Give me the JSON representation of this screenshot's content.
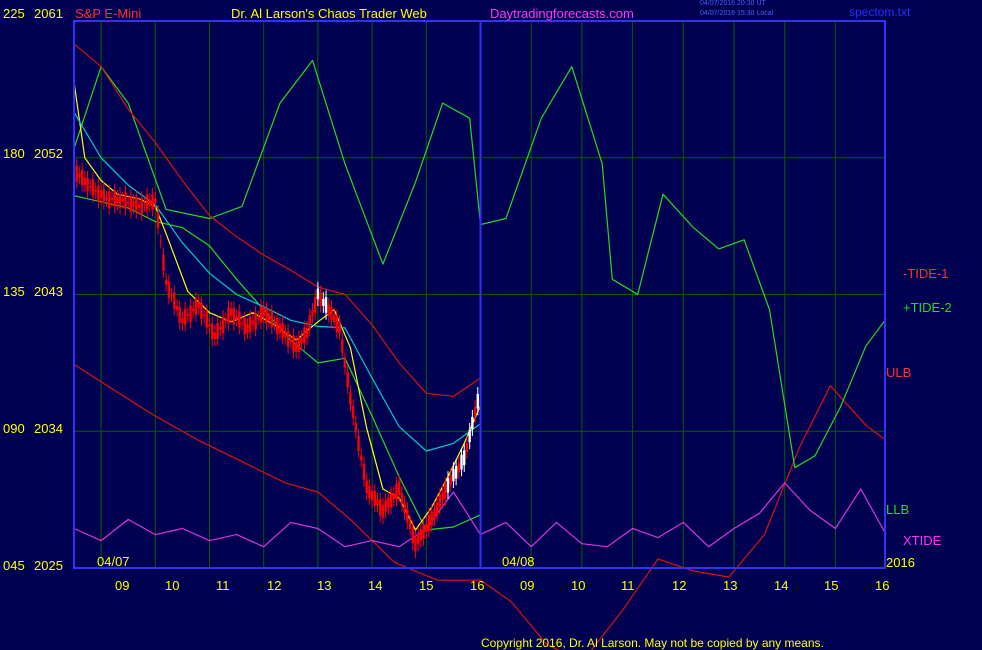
{
  "header": {
    "symbol": "S&P E-Mini",
    "title": "Dr. Al Larson's Chaos Trader Web",
    "website": "Daytradingforecasts.com",
    "stamp_ut": "04/07/2016 20:30 UT",
    "stamp_local": "04/07/2016 15:30 Local",
    "file": "spectom.txt"
  },
  "copyright": "Copyright 2016, Dr. Al Larson. May not be copied by any means.",
  "colors": {
    "background": "#000050",
    "plot_border": "#3030ff",
    "grid": "#006000",
    "axis_text": "#ffff00",
    "tide1": "#dd1010",
    "tide2": "#22dd22",
    "ulb": "#dd1010",
    "llb": "#22dd22",
    "xtide": "#dd33dd",
    "candle_down": "#ff0000",
    "candle_up": "#ffffff",
    "fast_ma": "#ffff00",
    "slow_ma": "#00cccc"
  },
  "chart_data": {
    "type": "line",
    "title": "S&P E-Mini",
    "y_axis_left": {
      "ticks": [
        "045",
        "090",
        "135",
        "180",
        "225"
      ],
      "range": [
        45,
        225
      ]
    },
    "y_axis_price": {
      "ticks": [
        "2025",
        "2034",
        "2043",
        "2052",
        "2061"
      ],
      "range": [
        2025,
        2061
      ]
    },
    "x_axis": {
      "hour_ticks": [
        "09",
        "10",
        "11",
        "12",
        "13",
        "14",
        "15",
        "16",
        "09",
        "10",
        "11",
        "12",
        "13",
        "14",
        "15",
        "16"
      ],
      "date_markers": [
        "04/07",
        "04/08"
      ],
      "year": "2016",
      "sessions": [
        "04/07",
        "04/08"
      ],
      "session_hours": [
        8.5,
        16.0
      ]
    },
    "series_labels": {
      "tide1": "-TIDE-1",
      "tide2": "+TIDE-2",
      "ulb": "ULB",
      "llb": "LLB",
      "xtide": "XTIDE"
    },
    "series": [
      {
        "name": "-TIDE-1",
        "unit": "index",
        "x": [
          8.5,
          9.2,
          10.0,
          10.8,
          11.6,
          12.4,
          13.0,
          13.6,
          14.4,
          15.2,
          16.0,
          16.6,
          17.3,
          18.0,
          18.8,
          19.5,
          20.2,
          20.9,
          21.6,
          22.3,
          22.9,
          23.6,
          24.0
        ],
        "y": [
          112,
          104,
          95,
          87,
          80,
          73,
          70,
          61,
          47,
          41,
          41,
          34,
          20,
          14,
          31,
          48,
          44,
          42,
          56,
          85,
          105,
          92,
          87
        ]
      },
      {
        "name": "+TIDE-2",
        "unit": "index",
        "x": [
          8.5,
          9.0,
          9.5,
          10.2,
          11.0,
          11.6,
          12.3,
          12.9,
          13.5,
          14.2,
          14.8,
          15.3,
          15.8,
          16.0,
          16.5,
          17.2,
          17.8,
          18.4,
          18.6,
          19.1,
          19.6,
          20.2,
          20.7,
          21.2,
          21.7,
          22.2,
          22.6,
          23.1,
          23.6,
          24.0
        ],
        "y": [
          183,
          210,
          198,
          163,
          160,
          164,
          198,
          212,
          178,
          145,
          172,
          198,
          193,
          158,
          160,
          193,
          210,
          178,
          140,
          135,
          168,
          157,
          150,
          153,
          130,
          78,
          82,
          98,
          118,
          127
        ]
      },
      {
        "name": "ULB",
        "unit": "price",
        "x": [
          8.5,
          9.0,
          9.5,
          10.0,
          10.5,
          11.0,
          11.5,
          12.0,
          12.5,
          13.0,
          13.5,
          14.0,
          14.5,
          15.0,
          15.5,
          16.0
        ],
        "y": [
          2059.5,
          2058,
          2055.2,
          2053,
          2050.5,
          2048.2,
          2046.8,
          2045.6,
          2044.6,
          2043.5,
          2043,
          2041,
          2038.5,
          2036.5,
          2036.3,
          2037.5
        ]
      },
      {
        "name": "LLB",
        "unit": "price",
        "x": [
          8.5,
          9.0,
          9.5,
          10.0,
          10.5,
          11.0,
          11.5,
          12.0,
          12.5,
          13.0,
          13.5,
          14.0,
          14.5,
          15.0,
          15.5,
          16.0
        ],
        "y": [
          2049.5,
          2049.1,
          2048.7,
          2047.8,
          2047.4,
          2046.2,
          2044,
          2042,
          2040,
          2038.5,
          2038.8,
          2035,
          2031,
          2027.5,
          2027.7,
          2028.5
        ]
      },
      {
        "name": "XTIDE",
        "unit": "index",
        "x": [
          8.5,
          9.0,
          9.5,
          10.0,
          10.5,
          11.0,
          11.5,
          12.0,
          12.5,
          13.0,
          13.5,
          14.0,
          14.5,
          15.0,
          15.5,
          16.0,
          16.5,
          17.0,
          17.5,
          18.0,
          18.5,
          19.0,
          19.5,
          20.0,
          20.5,
          21.0,
          21.5,
          22.0,
          22.5,
          23.0,
          23.5,
          24.0
        ],
        "y": [
          58,
          54,
          61,
          56,
          58,
          54,
          56,
          52,
          60,
          58,
          52,
          54,
          52,
          58,
          70,
          56,
          60,
          52,
          60,
          53,
          52,
          58,
          55,
          60,
          52,
          58,
          63,
          73,
          64,
          58,
          71,
          56
        ]
      },
      {
        "name": "Price",
        "unit": "price",
        "x": [
          8.5,
          8.8,
          9.1,
          9.4,
          9.7,
          10.0,
          10.2,
          10.5,
          10.8,
          11.1,
          11.4,
          11.7,
          12.0,
          12.3,
          12.6,
          12.8,
          13.0,
          13.2,
          13.4,
          13.6,
          13.9,
          14.2,
          14.5,
          14.8,
          15.1,
          15.4,
          15.7,
          16.0
        ],
        "y": [
          2051.2,
          2050.1,
          2049.3,
          2049.2,
          2048.8,
          2049.2,
          2043.8,
          2041.3,
          2042.3,
          2040.3,
          2041.8,
          2040.8,
          2041.8,
          2040.8,
          2039.5,
          2040.5,
          2043,
          2042,
          2040.8,
          2036.2,
          2030.3,
          2028.8,
          2030.2,
          2026.6,
          2028.2,
          2030.5,
          2032.2,
          2036.8
        ]
      },
      {
        "name": "Fast MA",
        "unit": "price",
        "x": [
          8.5,
          8.7,
          9.0,
          9.3,
          9.7,
          10.0,
          10.2,
          10.6,
          11.0,
          11.4,
          11.8,
          12.2,
          12.6,
          13.0,
          13.3,
          13.6,
          13.9,
          14.2,
          14.5,
          14.8,
          15.1,
          15.4,
          15.7,
          16.0
        ],
        "y": [
          2057,
          2052,
          2050.5,
          2049.6,
          2049.3,
          2048.8,
          2047,
          2043.2,
          2041.8,
          2041.2,
          2041.8,
          2041,
          2040,
          2041.2,
          2042,
          2039.5,
          2034.2,
          2030.2,
          2029.6,
          2027.5,
          2029,
          2031,
          2033.2,
          2035.7
        ]
      },
      {
        "name": "Slow MA",
        "unit": "price",
        "x": [
          8.5,
          9.0,
          9.5,
          10.0,
          10.5,
          11.0,
          11.5,
          12.0,
          12.5,
          13.0,
          13.5,
          14.0,
          14.5,
          15.0,
          15.5,
          16.0
        ],
        "y": [
          2055,
          2052,
          2050.2,
          2048.9,
          2046.4,
          2044.4,
          2043,
          2042.2,
          2041.3,
          2040.9,
          2040.8,
          2037.5,
          2034.3,
          2032.7,
          2033.2,
          2034.5
        ]
      }
    ]
  }
}
